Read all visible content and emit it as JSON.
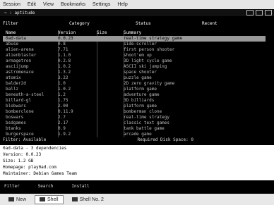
{
  "menu": [
    "Session",
    "Edit",
    "View",
    "Bookmarks",
    "Settings",
    "Help"
  ],
  "title": "~ : aptitude",
  "filters": [
    "Filter",
    "Category",
    "Status",
    "Recent"
  ],
  "columns": [
    "Name",
    "Version",
    "Size",
    "Summary"
  ],
  "rows": [
    {
      "name": "0ad-data",
      "ver": "0.0.23",
      "size": "",
      "summary": "real-time strategy game",
      "selected": true
    },
    {
      "name": "abuse",
      "ver": "0.8",
      "size": "",
      "summary": "side-scroller"
    },
    {
      "name": "alien-arena",
      "ver": "7.71",
      "size": "",
      "summary": "first person shooter"
    },
    {
      "name": "alienblaster",
      "ver": "1.1.0",
      "size": "",
      "summary": "shoot'em up"
    },
    {
      "name": "armagetron",
      "ver": "0.2.8",
      "size": "",
      "summary": "3D light cycle game"
    },
    {
      "name": "asciijump",
      "ver": "1.0.2",
      "size": "",
      "summary": "ASCII ski jumping"
    },
    {
      "name": "astromenace",
      "ver": "1.3.2",
      "size": "",
      "summary": "space shooter"
    },
    {
      "name": "atomix",
      "ver": "3.22",
      "size": "",
      "summary": "puzzle game"
    },
    {
      "name": "balder2d",
      "ver": "1.0",
      "size": "",
      "summary": "2D zero gravity game"
    },
    {
      "name": "ballz",
      "ver": "1.0.2",
      "size": "",
      "summary": "platform game"
    },
    {
      "name": "beneath-a-steel",
      "ver": "1.2",
      "size": "",
      "summary": "adventure game"
    },
    {
      "name": "billard-gl",
      "ver": "1.75",
      "size": "",
      "summary": "3D billiards"
    },
    {
      "name": "blobwars",
      "ver": "2.00",
      "size": "",
      "summary": "platform game"
    },
    {
      "name": "bomberclone",
      "ver": "0.11.9",
      "size": "",
      "summary": "bomberman clone"
    },
    {
      "name": "boswars",
      "ver": "2.7",
      "size": "",
      "summary": "real-time strategy"
    },
    {
      "name": "bsdgames",
      "ver": "2.17",
      "size": "",
      "summary": "classic text games"
    },
    {
      "name": "btanks",
      "ver": "0.9",
      "size": "",
      "summary": "tank battle game"
    },
    {
      "name": "burgerspace",
      "ver": "1.9.2",
      "size": "",
      "summary": "arcade game"
    }
  ],
  "status_left": "Filter: Available",
  "status_right": "Required Disk Space: 0",
  "details": [
    "0ad-data - 3 dependencies",
    "Version: 0.0.23",
    "Size: 1.2 GB",
    "Homepage: play0ad.com",
    "Maintainer: Debian Games Team"
  ],
  "statusbar": [
    "Filter",
    "Search",
    "Install"
  ],
  "tabs": [
    "New",
    "Shell",
    "Shell No. 2"
  ]
}
